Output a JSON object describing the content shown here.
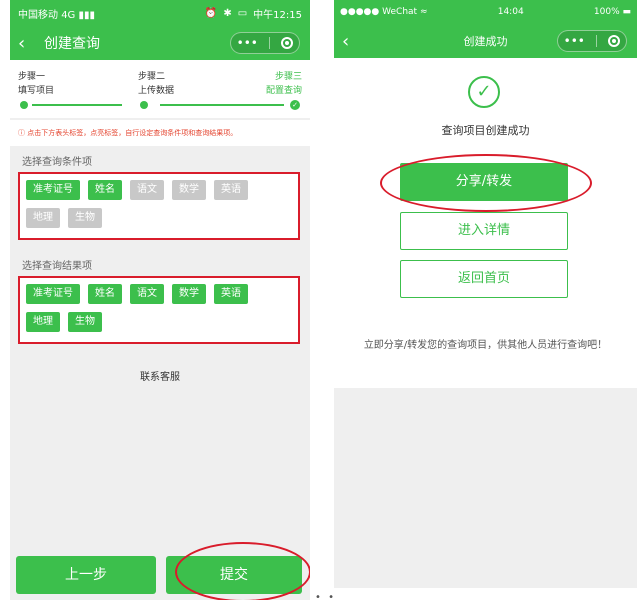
{
  "left": {
    "status": {
      "carrier": "中国移动",
      "signal": "4G",
      "time": "中午12:15"
    },
    "nav": {
      "title": "创建查询"
    },
    "steps": [
      {
        "step": "步骤一",
        "label": "填写项目"
      },
      {
        "step": "步骤二",
        "label": "上传数据"
      },
      {
        "step": "步骤三",
        "label": "配置查询"
      }
    ],
    "tip": "点击下方表头标签，点亮标签，自行设定查询条件项和查询结果项。",
    "condition_title": "选择查询条件项",
    "condition_tags": [
      [
        {
          "label": "准考证号",
          "active": true
        },
        {
          "label": "姓名",
          "active": true
        },
        {
          "label": "语文",
          "active": false
        },
        {
          "label": "数学",
          "active": false
        },
        {
          "label": "英语",
          "active": false
        }
      ],
      [
        {
          "label": "地理",
          "active": false
        },
        {
          "label": "生物",
          "active": false
        }
      ]
    ],
    "result_title": "选择查询结果项",
    "result_tags": [
      [
        {
          "label": "准考证号",
          "active": true
        },
        {
          "label": "姓名",
          "active": true
        },
        {
          "label": "语文",
          "active": true
        },
        {
          "label": "数学",
          "active": true
        },
        {
          "label": "英语",
          "active": true
        }
      ],
      [
        {
          "label": "地理",
          "active": true
        },
        {
          "label": "生物",
          "active": true
        }
      ]
    ],
    "contact": "联系客服",
    "buttons": {
      "prev": "上一步",
      "submit": "提交"
    }
  },
  "right": {
    "status": {
      "carrier": "WeChat",
      "time": "14:04",
      "battery": "100%"
    },
    "nav": {
      "title": "创建成功"
    },
    "success_text": "查询项目创建成功",
    "buttons": {
      "share": "分享/转发",
      "detail": "进入详情",
      "home": "返回首页"
    },
    "hint": "立即分享/转发您的查询项目，供其他人员进行查询吧！"
  },
  "colors": {
    "accent": "#3cbf4c",
    "annotation": "#d91c2b",
    "tag_inactive": "#c8c8c8",
    "tip": "#e4442f"
  }
}
